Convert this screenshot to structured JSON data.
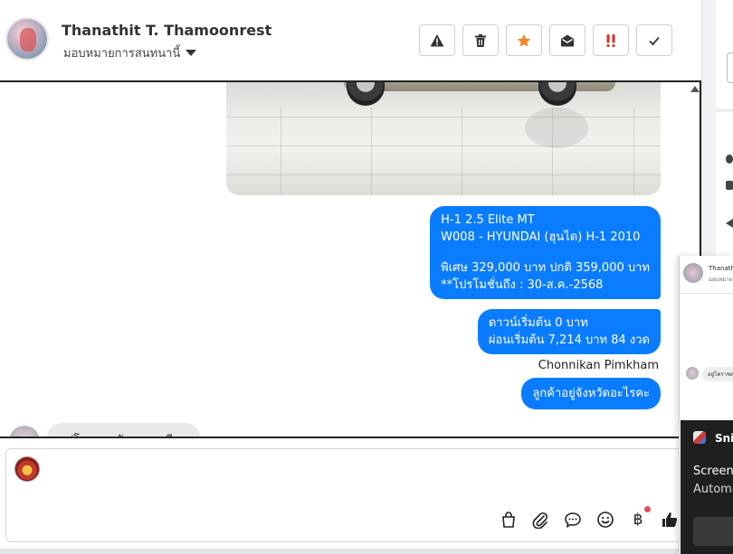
{
  "header": {
    "contact_name": "Thanathit T. Thamoonrest",
    "assign_label": "มอบหมายการสนทนานี้",
    "toolbar": [
      {
        "name": "spam-button",
        "icon": "warning-icon",
        "color": "#333333"
      },
      {
        "name": "delete-button",
        "icon": "trash-icon",
        "color": "#333333"
      },
      {
        "name": "star-button",
        "icon": "star-icon",
        "color": "#f0872a"
      },
      {
        "name": "mark-unread-button",
        "icon": "envelope-open-icon",
        "color": "#333333"
      },
      {
        "name": "important-button",
        "icon": "double-exclamation-icon",
        "color": "#d93025"
      },
      {
        "name": "done-button",
        "icon": "check-icon",
        "color": "#333333"
      }
    ]
  },
  "messages": {
    "bubble1": {
      "line1": "H-1 2.5 Elite MT",
      "line2": "W008 - HYUNDAI (ฮุนได) H-1 2010",
      "line3": "พิเศษ 329,000 บาท  ปกติ 359,000 บาท",
      "line4": "**โปรโมชั่นถึง : 30-ส.ค.-2568"
    },
    "bubble2": {
      "line1": "ดาวน์เริ่มต้น 0 บาท",
      "line2": "ผ่อนเริ่มต้น 7,214 บาท 84 งวด"
    },
    "sender_name": "Chonnikan Pimkham",
    "bubble3": "ลูกค้าอยู่จังหวัดอะไรคะ",
    "incoming_partial": "อยู่โคราชครับ แถวๆ สีดา",
    "bubble_color": "#0a7cff"
  },
  "composer": {
    "icons": [
      "shopping-bag-icon",
      "paperclip-icon",
      "chat-bubble-icon",
      "smiley-icon",
      "baht-icon",
      "thumbs-up-icon"
    ],
    "baht_symbol": "฿"
  },
  "floating_chat": {
    "name": "Thanathit",
    "sub": "มอบหมาย",
    "message": "อยู่โคราชค"
  },
  "snip_notification": {
    "title": "Snip",
    "line1": "Screens",
    "line2": "Automa"
  }
}
